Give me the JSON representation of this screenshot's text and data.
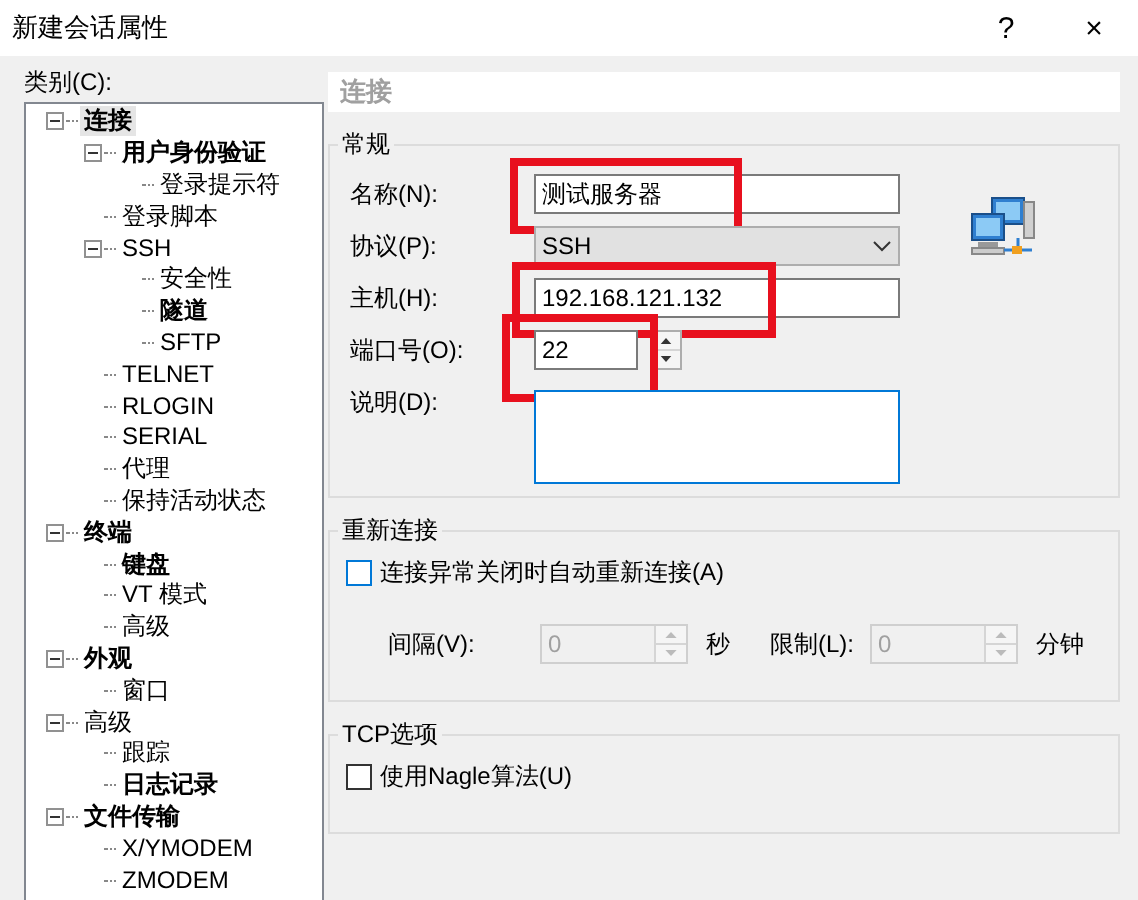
{
  "window": {
    "title": "新建会话属性",
    "buttons": [
      "?",
      "×"
    ]
  },
  "category_label": "类别(C):",
  "tree": [
    {
      "label": "连接",
      "bold": true,
      "selected": true,
      "expanded": true,
      "children": [
        {
          "label": "用户身份验证",
          "bold": true,
          "selected": false,
          "expanded": true,
          "children": [
            {
              "label": "登录提示符",
              "bold": false,
              "selected": false
            }
          ]
        },
        {
          "label": "登录脚本",
          "bold": false,
          "selected": false
        },
        {
          "label": "SSH",
          "bold": false,
          "selected": false,
          "expanded": true,
          "children": [
            {
              "label": "安全性",
              "bold": false,
              "selected": false
            },
            {
              "label": "隧道",
              "bold": true,
              "selected": false
            },
            {
              "label": "SFTP",
              "bold": false,
              "selected": false
            }
          ]
        },
        {
          "label": "TELNET",
          "bold": false,
          "selected": false
        },
        {
          "label": "RLOGIN",
          "bold": false,
          "selected": false
        },
        {
          "label": "SERIAL",
          "bold": false,
          "selected": false
        },
        {
          "label": "代理",
          "bold": false,
          "selected": false
        },
        {
          "label": "保持活动状态",
          "bold": false,
          "selected": false
        }
      ]
    },
    {
      "label": "终端",
      "bold": true,
      "selected": false,
      "expanded": true,
      "children": [
        {
          "label": "键盘",
          "bold": true,
          "selected": false
        },
        {
          "label": "VT 模式",
          "bold": false,
          "selected": false
        },
        {
          "label": "高级",
          "bold": false,
          "selected": false
        }
      ]
    },
    {
      "label": "外观",
      "bold": true,
      "selected": false,
      "expanded": true,
      "children": [
        {
          "label": "窗口",
          "bold": false,
          "selected": false
        }
      ]
    },
    {
      "label": "高级",
      "bold": false,
      "selected": false,
      "expanded": true,
      "children": [
        {
          "label": "跟踪",
          "bold": false,
          "selected": false
        },
        {
          "label": "日志记录",
          "bold": true,
          "selected": false
        }
      ]
    },
    {
      "label": "文件传输",
      "bold": true,
      "selected": false,
      "expanded": true,
      "children": [
        {
          "label": "X/YMODEM",
          "bold": false,
          "selected": false
        },
        {
          "label": "ZMODEM",
          "bold": false,
          "selected": false
        }
      ]
    }
  ],
  "panel": {
    "header": "连接",
    "general": {
      "title": "常规",
      "fields": [
        {
          "kind": "text",
          "label": "名称(N):",
          "value": "测试服务器",
          "highlighted": true
        },
        {
          "kind": "dropdown",
          "label": "协议(P):",
          "value": "SSH",
          "highlighted": false
        },
        {
          "kind": "text",
          "label": "主机(H):",
          "value": "192.168.121.132",
          "highlighted": true
        },
        {
          "kind": "spin",
          "label": "端口号(O):",
          "value": "22",
          "highlighted": true
        },
        {
          "kind": "textarea",
          "label": "说明(D):",
          "highlighted": false
        }
      ]
    },
    "reconnect": {
      "title": "重新连接",
      "checkbox": {
        "label": "连接异常关闭时自动重新连接(A)",
        "checked": false
      },
      "spins": [
        {
          "label": "间隔(V):",
          "value": "0",
          "unit": "秒",
          "disabled": true
        },
        {
          "label": "限制(L):",
          "value": "0",
          "unit": "分钟",
          "disabled": true
        }
      ]
    },
    "tcp": {
      "title": "TCP选项",
      "checkbox": {
        "label": "使用Nagle算法(U)",
        "checked": false
      }
    }
  }
}
